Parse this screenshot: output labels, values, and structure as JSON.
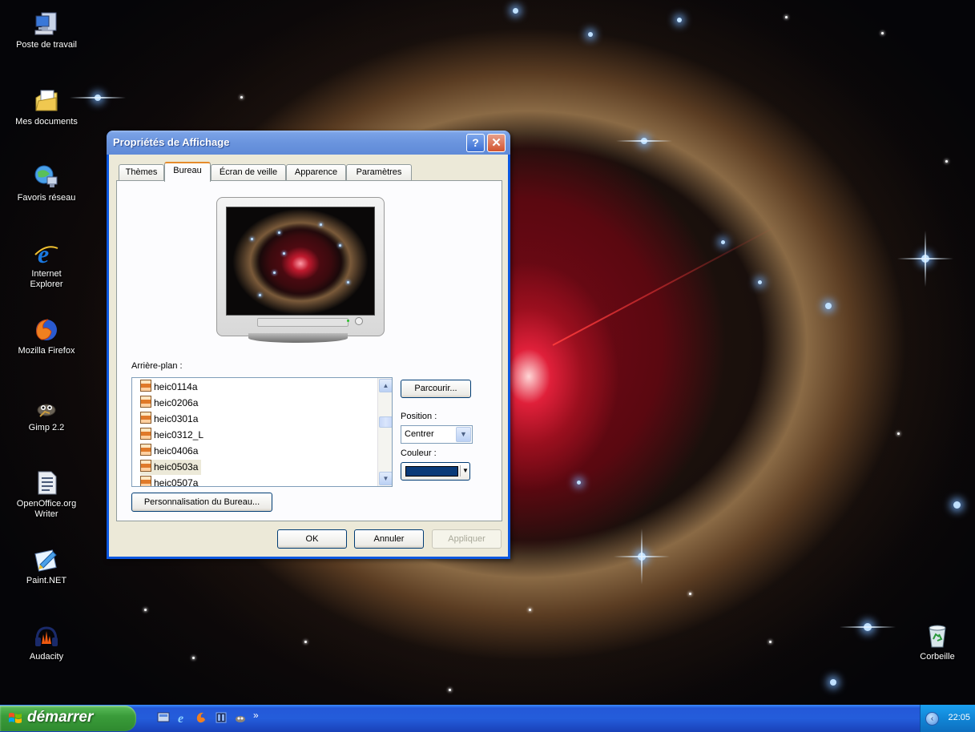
{
  "desktop": {
    "icons": [
      {
        "label": "Poste de travail",
        "icon": "my-computer-icon"
      },
      {
        "label": "Mes documents",
        "icon": "my-documents-icon"
      },
      {
        "label": "Favoris réseau",
        "icon": "network-places-icon"
      },
      {
        "label": "Internet Explorer",
        "icon": "internet-explorer-icon"
      },
      {
        "label": "Mozilla Firefox",
        "icon": "firefox-icon"
      },
      {
        "label": "Gimp 2.2",
        "icon": "gimp-icon"
      },
      {
        "label": "OpenOffice.org Writer",
        "icon": "openoffice-writer-icon"
      },
      {
        "label": "Paint.NET",
        "icon": "paint-net-icon"
      },
      {
        "label": "Audacity",
        "icon": "audacity-icon"
      },
      {
        "label": "Corbeille",
        "icon": "recycle-bin-icon"
      }
    ]
  },
  "dialog": {
    "title": "Propriétés de Affichage",
    "help_label": "?",
    "close_label": "✕",
    "tabs": [
      {
        "label": "Thèmes",
        "active": false
      },
      {
        "label": "Bureau",
        "active": true
      },
      {
        "label": "Écran de veille",
        "active": false
      },
      {
        "label": "Apparence",
        "active": false
      },
      {
        "label": "Paramètres",
        "active": false
      }
    ],
    "background_label": "Arrière-plan :",
    "backgrounds": [
      "heic0114a",
      "heic0206a",
      "heic0301a",
      "heic0312_L",
      "heic0406a",
      "heic0503a",
      "heic0507a"
    ],
    "selected_background": "heic0503a",
    "browse_label": "Parcourir...",
    "position_label": "Position :",
    "position_value": "Centrer",
    "color_label": "Couleur :",
    "color_value": "#0a3a78",
    "customize_label": "Personnalisation du Bureau...",
    "ok_label": "OK",
    "cancel_label": "Annuler",
    "apply_label": "Appliquer"
  },
  "taskbar": {
    "start_label": "démarrer",
    "quick_launch": [
      "desktop-show-icon",
      "internet-explorer-icon",
      "firefox-icon",
      "media-icon",
      "gimp-icon"
    ],
    "overflow_label": "»",
    "clock": "22:05"
  }
}
